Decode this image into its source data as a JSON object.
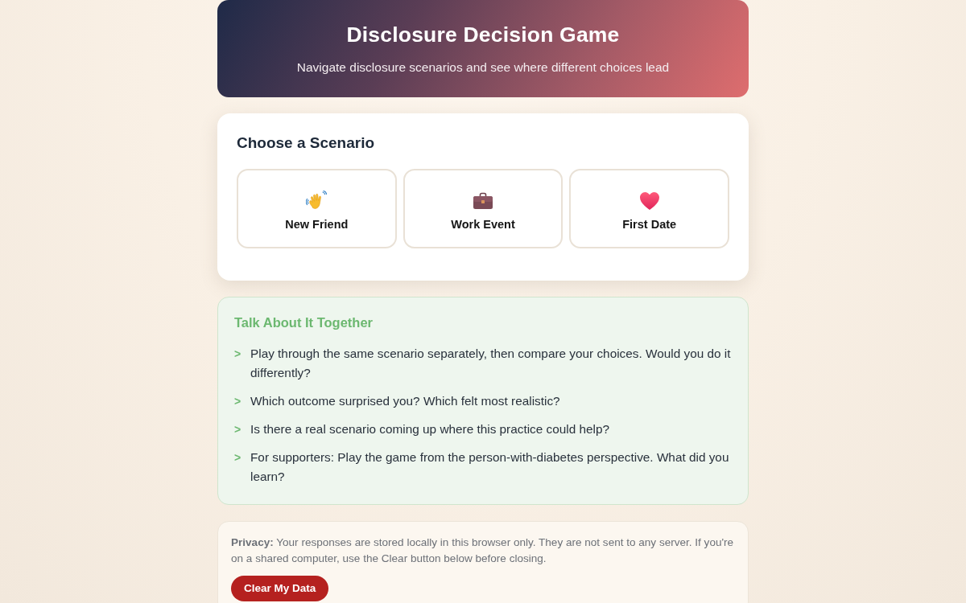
{
  "header": {
    "title": "Disclosure Decision Game",
    "subtitle": "Navigate disclosure scenarios and see where different choices lead"
  },
  "scenarios": {
    "title": "Choose a Scenario",
    "options": [
      {
        "kind": "wave",
        "label": "New Friend"
      },
      {
        "kind": "briefcase",
        "label": "Work Event"
      },
      {
        "kind": "heart",
        "label": "First Date"
      }
    ]
  },
  "discussion": {
    "title": "Talk About It Together",
    "items": [
      {
        "marker": ">",
        "text": "Play through the same scenario separately, then compare your choices. Would you do it differently?"
      },
      {
        "marker": ">",
        "text": "Which outcome surprised you? Which felt most realistic?"
      },
      {
        "marker": ">",
        "text": "Is there a real scenario coming up where this practice could help?"
      },
      {
        "marker": ">",
        "text": "For supporters: Play the game from the person-with-diabetes perspective. What did you learn?"
      }
    ]
  },
  "privacy": {
    "text": "**Privacy:** Your responses are stored locally in this browser only. They are not sent to any server. If you're on a shared computer, use the Clear button below before closing.",
    "button": "Clear My Data"
  }
}
